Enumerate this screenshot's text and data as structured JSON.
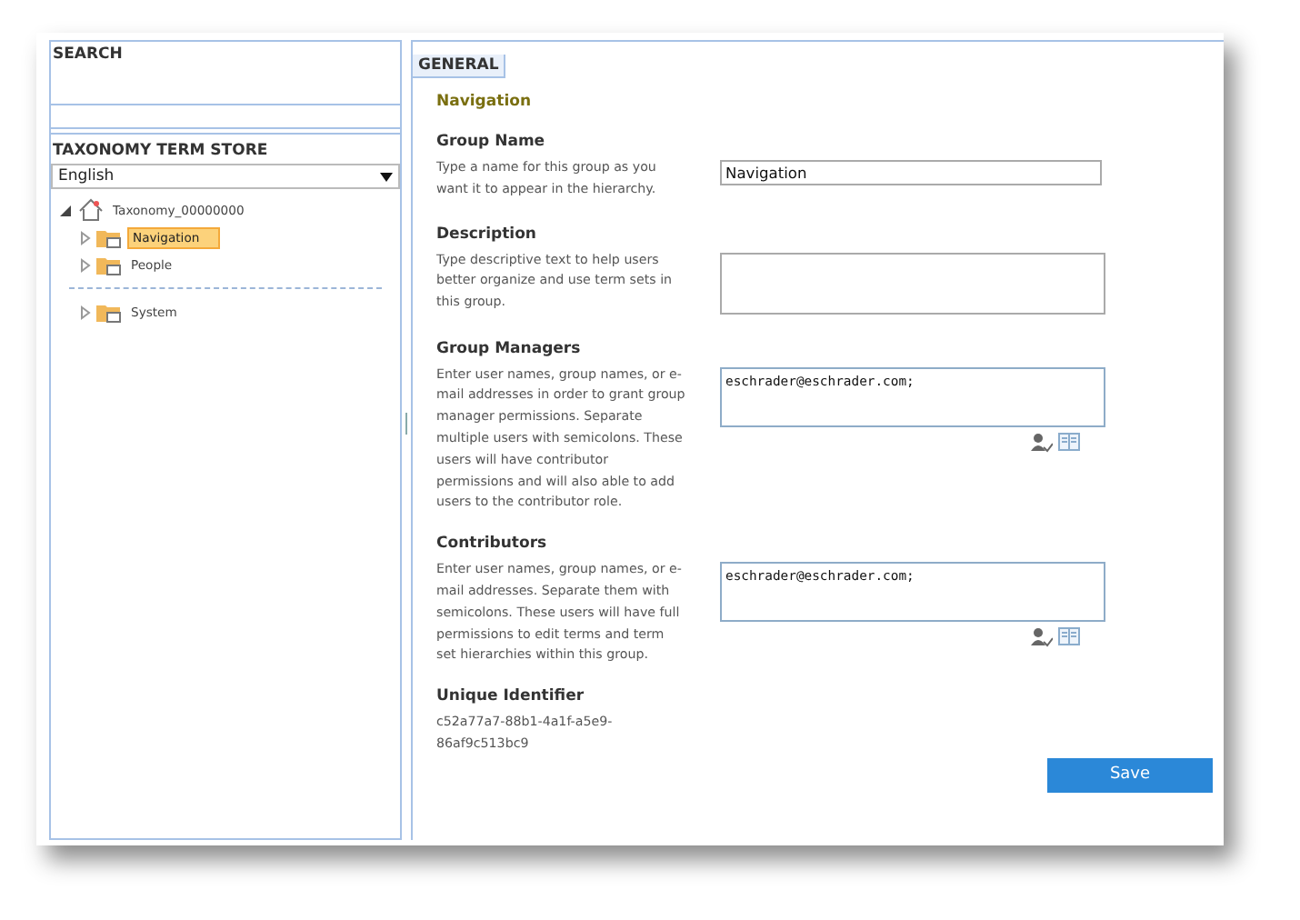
{
  "left_panel": {
    "search_title": "SEARCH",
    "store_title": "TAXONOMY TERM STORE",
    "language": "English",
    "tree": [
      {
        "label": "Taxonomy_00000000",
        "kind": "store",
        "expanded": true,
        "selected": false,
        "children": [
          {
            "label": "Navigation",
            "kind": "group",
            "expanded": false,
            "selected": true
          },
          {
            "label": "People",
            "kind": "group",
            "expanded": false,
            "selected": false
          }
        ]
      }
    ],
    "system_items": [
      {
        "label": "System",
        "kind": "group",
        "expanded": false,
        "selected": false
      }
    ]
  },
  "main": {
    "tab": "GENERAL",
    "heading": "Navigation",
    "fields": [
      {
        "kind": "text",
        "label": "Group Name",
        "description": "Type a name for this group as you want it to appear in the hierarchy.",
        "value": "Navigation"
      },
      {
        "kind": "textarea",
        "label": "Description",
        "description": "Type descriptive text to help users better organize and use term sets in this group."
      },
      {
        "kind": "people",
        "label": "Group Managers",
        "description": "Enter user names, group names, or e-mail addresses in order to grant group manager permissions. Separate multiple users with semicolons. These users will have contributor permissions and will also able to add users to the contributor role.",
        "value": "eschrader@eschrader.com;"
      },
      {
        "kind": "people",
        "label": "Contributors",
        "description": "Enter user names, group names, or e-mail addresses. Separate them with semicolons. These users will have full permissions to edit terms and term set hierarchies within this group.",
        "value": "eschrader@eschrader.com;"
      },
      {
        "kind": "readonly",
        "label": "Unique Identifier",
        "value": "c52a77a7-88b1-4a1f-a5e9-86af9c513bc9"
      }
    ],
    "save_button": "Save"
  }
}
